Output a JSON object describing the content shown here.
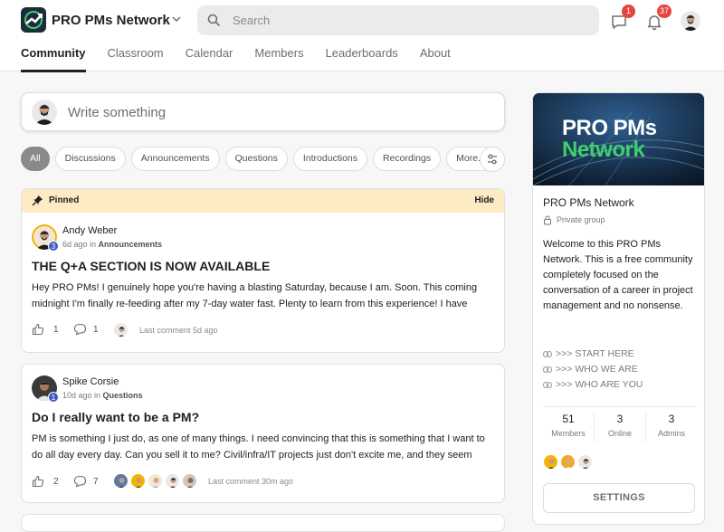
{
  "header": {
    "group_name": "PRO PMs Network",
    "search_placeholder": "Search",
    "chat_badge": "1",
    "notif_badge": "37"
  },
  "nav": {
    "tabs": [
      {
        "label": "Community",
        "active": true
      },
      {
        "label": "Classroom"
      },
      {
        "label": "Calendar"
      },
      {
        "label": "Members"
      },
      {
        "label": "Leaderboards"
      },
      {
        "label": "About"
      }
    ]
  },
  "composer": {
    "placeholder": "Write something"
  },
  "filters": {
    "chips": [
      "All",
      "Discussions",
      "Announcements",
      "Questions",
      "Introductions",
      "Recordings",
      "More..."
    ]
  },
  "posts": [
    {
      "pinned_label": "Pinned",
      "hide_label": "Hide",
      "author": "Andy Weber",
      "level": "3",
      "time": "6d ago in ",
      "category": "Announcements",
      "title": "THE Q+A SECTION IS NOW AVAILABLE",
      "body": "Hey PRO PMs! I genuinely hope you're having a blasting Saturday, because I am. Soon. This coming midnight I'm finally re-feeding after my 7-day water fast. Plenty to learn from this experience! I have",
      "likes": "1",
      "comments": "1",
      "last_comment": "Last comment 5d ago"
    },
    {
      "author": "Spike Corsie",
      "level": "1",
      "time": "10d ago in ",
      "category": "Questions",
      "title": "Do I really want to be a PM?",
      "body": "PM is something I just do, as one of many things. I need convincing that this is something that I want to do all day every day. Can you sell it to me? Civil/infra/IT projects just don't excite me, and they seem",
      "likes": "2",
      "comments": "7",
      "last_comment": "Last comment 30m ago"
    }
  ],
  "sidebar": {
    "banner_line1": "PRO PMs",
    "banner_line2": "Network",
    "title": "PRO PMs Network",
    "privacy": "Private group",
    "description": "Welcome to this PRO PMs Network. This is a free community completely focused on the conversation of a career in project management and no nonsense.",
    "links": [
      ">>> START HERE",
      ">>> WHO WE ARE",
      ">>> WHO ARE YOU"
    ],
    "stats": [
      {
        "value": "51",
        "label": "Members"
      },
      {
        "value": "3",
        "label": "Online"
      },
      {
        "value": "3",
        "label": "Admins"
      }
    ],
    "settings_label": "SETTINGS"
  },
  "colors": {
    "accent_green": "#3ecf6e",
    "badge_red": "#e5453a",
    "pin_bg": "#fcebc3",
    "level_blue": "#3b5cc4"
  }
}
